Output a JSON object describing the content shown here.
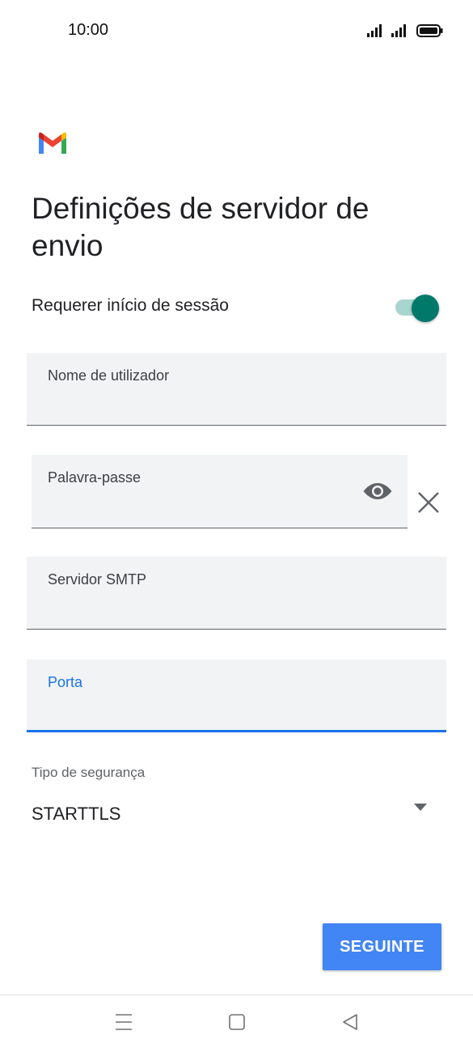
{
  "status_bar": {
    "time": "10:00"
  },
  "page": {
    "title": "Definições de servidor de envio"
  },
  "require_login": {
    "label": "Requerer início de sessão",
    "enabled": true
  },
  "fields": {
    "username": {
      "label": "Nome de utilizador",
      "value": ""
    },
    "password": {
      "label": "Palavra-passe",
      "value": ""
    },
    "smtp_server": {
      "label": "Servidor SMTP",
      "value": ""
    },
    "port": {
      "label": "Porta",
      "value": ""
    }
  },
  "security": {
    "label": "Tipo de segurança",
    "value": "STARTTLS"
  },
  "next_button": {
    "label": "SEGUINTE"
  },
  "colors": {
    "accent": "#00796b",
    "focus": "#1a73e8",
    "button": "#4285f4"
  },
  "icons": [
    "signal-icon",
    "battery-icon",
    "gmail-logo",
    "eye-icon",
    "close-icon",
    "caret-down-icon",
    "menu-icon",
    "home-icon",
    "back-icon"
  ]
}
